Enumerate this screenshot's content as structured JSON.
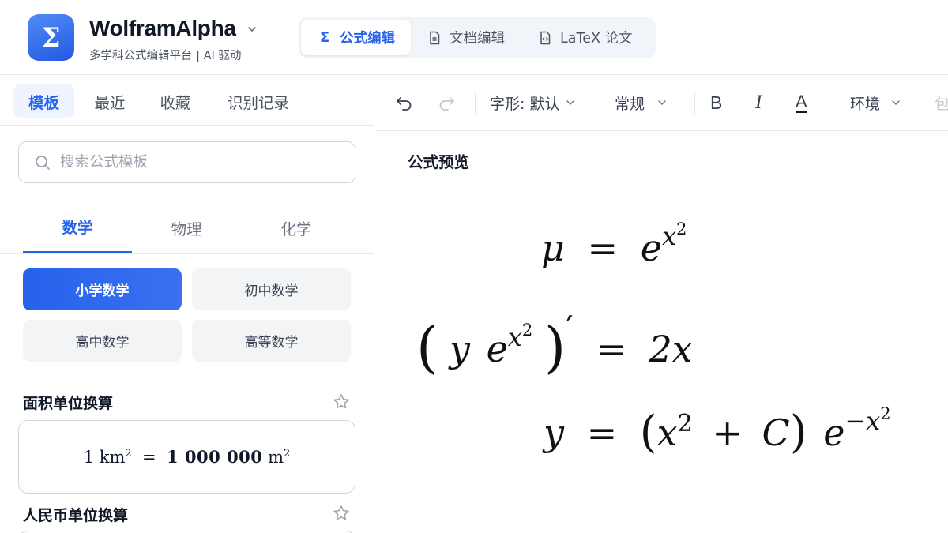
{
  "header": {
    "logo_symbol": "Σ",
    "brand_name": "WolframAlpha",
    "brand_subtitle": "多学科公式编辑平台 | AI 驱动",
    "modes": [
      {
        "label": "公式编辑",
        "icon": "sigma-icon",
        "active": true
      },
      {
        "label": "文档编辑",
        "icon": "document-icon",
        "active": false
      },
      {
        "label": "LaTeX 论文",
        "icon": "code-file-icon",
        "active": false
      }
    ]
  },
  "sidebar": {
    "tabs": [
      {
        "label": "模板",
        "active": true
      },
      {
        "label": "最近",
        "active": false
      },
      {
        "label": "收藏",
        "active": false
      },
      {
        "label": "识别记录",
        "active": false
      }
    ],
    "search": {
      "placeholder": "搜索公式模板",
      "value": ""
    },
    "subjects": [
      {
        "label": "数学",
        "active": true
      },
      {
        "label": "物理",
        "active": false
      },
      {
        "label": "化学",
        "active": false
      }
    ],
    "grades": [
      {
        "label": "小学数学",
        "active": true
      },
      {
        "label": "初中数学",
        "active": false
      },
      {
        "label": "高中数学",
        "active": false
      },
      {
        "label": "高等数学",
        "active": false
      }
    ],
    "cards": [
      {
        "title": "面积单位换算",
        "formula": {
          "lhs_num": "1",
          "lhs_unit": "km",
          "lhs_exp": "2",
          "eq": "=",
          "rhs_num": "1 000 000",
          "rhs_unit": "m",
          "rhs_exp": "2"
        }
      },
      {
        "title": "人民币单位换算"
      }
    ]
  },
  "toolbar": {
    "undo_icon": "undo-icon",
    "redo_icon": "redo-icon",
    "font_label": "字形: 默认",
    "style_label": "常规",
    "bold_icon": "bold-icon",
    "italic_icon": "italic-icon",
    "color_icon": "text-color-icon",
    "env_label": "环境",
    "cut_label": "包"
  },
  "preview": {
    "label": "公式预览",
    "equations": [
      {
        "lhs": "μ",
        "eq": "=",
        "base": "e",
        "sup": "x",
        "supsup": "2"
      },
      {
        "open": "(",
        "y": "y",
        "base": "e",
        "sup": "x",
        "supsup": "2",
        "close": ")",
        "prime": "′",
        "eq": "=",
        "rhs": "2x"
      },
      {
        "lhs": "y",
        "eq": "=",
        "open": "(",
        "x": "x",
        "xexp": "2",
        "plus": "+",
        "c": "C",
        "close": ")",
        "base": "e",
        "sup": "−x",
        "supsup": "2"
      }
    ]
  },
  "colors": {
    "accent": "#2563eb",
    "border": "#e5e7eb",
    "muted": "#6b7280"
  }
}
